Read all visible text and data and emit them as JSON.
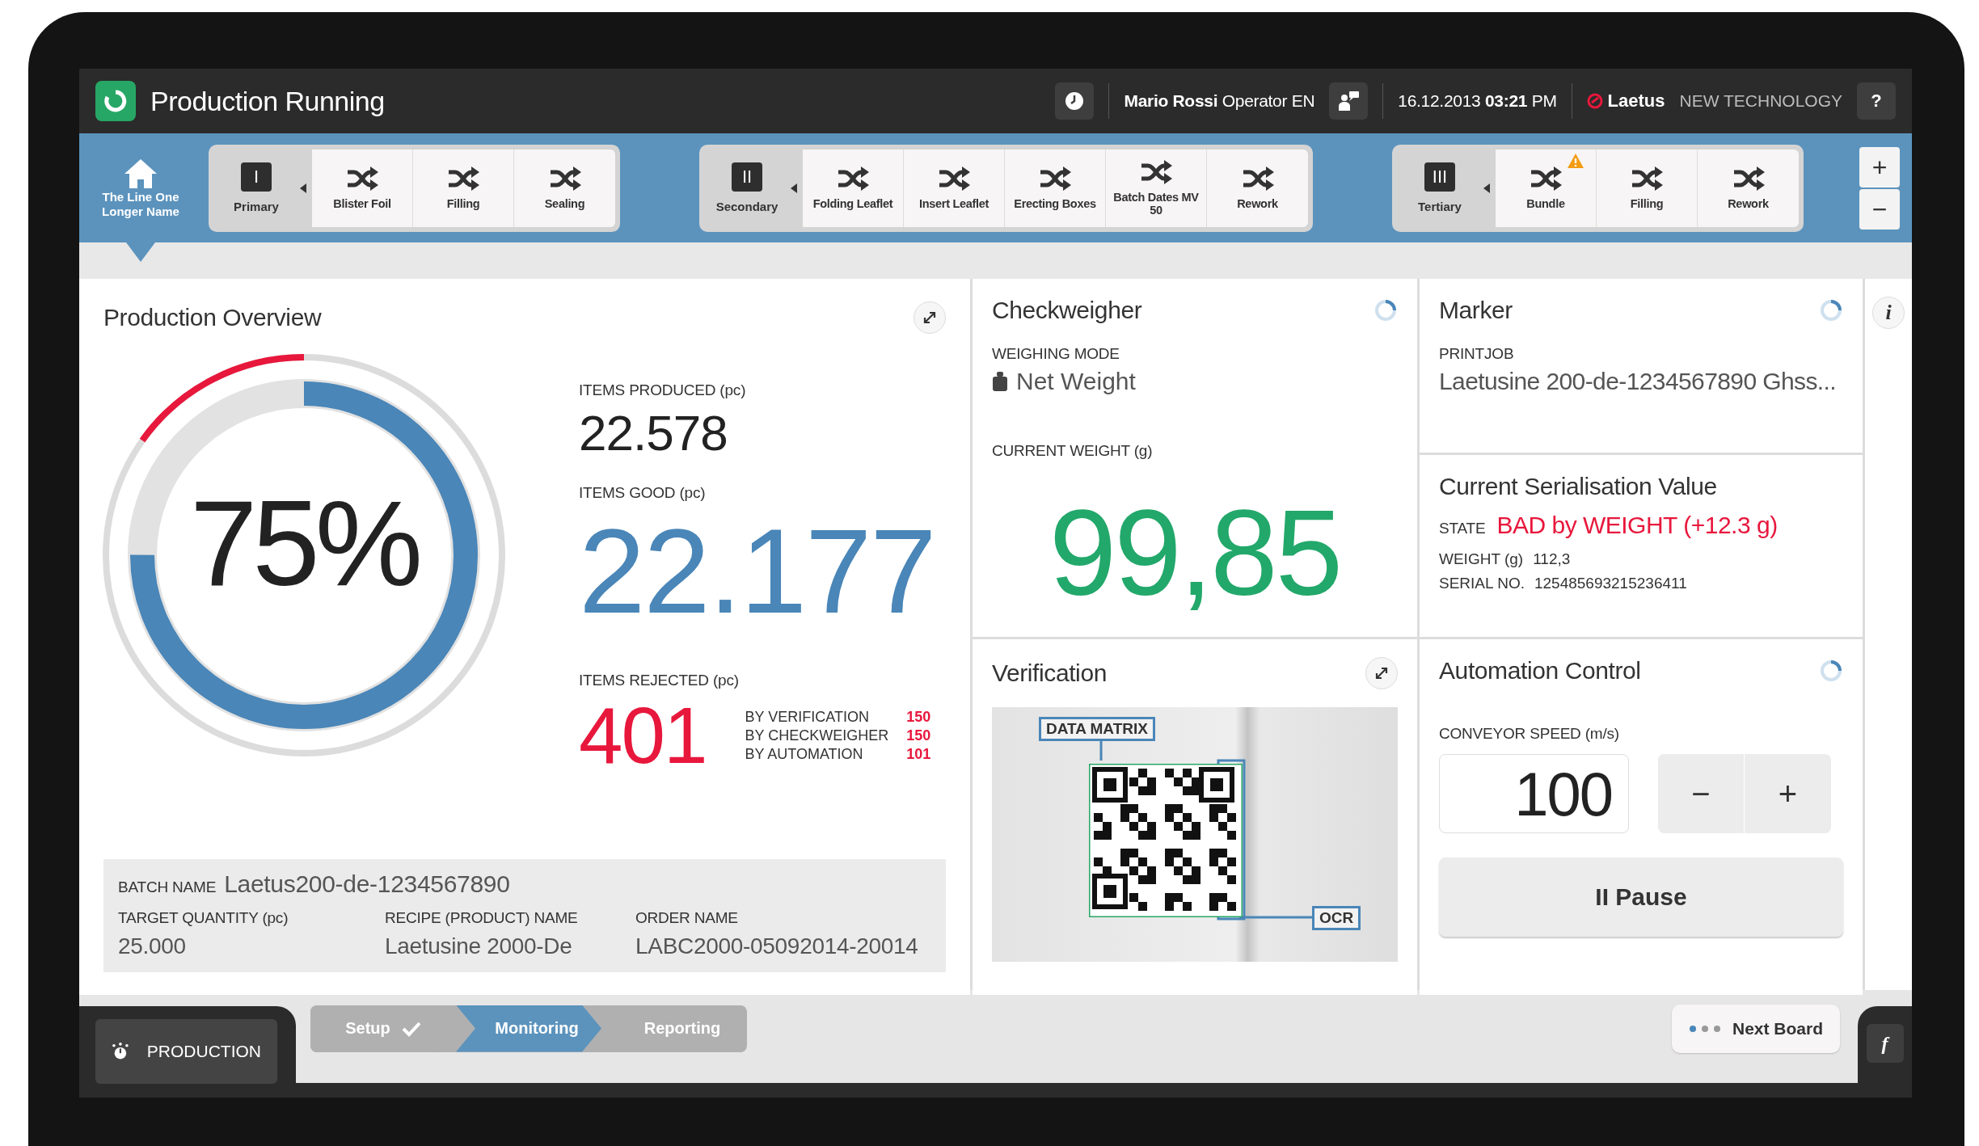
{
  "header": {
    "title": "Production Running",
    "user": "**Mario Rossi** Operator EN",
    "datetime": "16.12.2013 **03:21** PM",
    "brand": "Laetus",
    "brand_tagline": "NEW TECHNOLOGY",
    "help": "?"
  },
  "line": {
    "name": "The Line One Longer Name",
    "selected": true
  },
  "groups": [
    {
      "name": "Primary",
      "numeral": "I",
      "stations": [
        {
          "label": "Blister Foil",
          "warning": false
        },
        {
          "label": "Filling",
          "warning": false
        },
        {
          "label": "Sealing",
          "warning": false
        }
      ]
    },
    {
      "name": "Secondary",
      "numeral": "II",
      "stations": [
        {
          "label": "Folding Leaflet",
          "warning": false
        },
        {
          "label": "Insert Leaflet",
          "warning": false
        },
        {
          "label": "Erecting Boxes",
          "warning": false
        },
        {
          "label": "Batch Dates MV 50",
          "warning": false
        },
        {
          "label": "Rework",
          "warning": false
        }
      ]
    },
    {
      "name": "Tertiary",
      "numeral": "III",
      "stations": [
        {
          "label": "Bundle",
          "warning": true
        },
        {
          "label": "Filling",
          "warning": false
        },
        {
          "label": "Rework",
          "warning": false
        }
      ]
    }
  ],
  "zoom": [
    "+",
    "−"
  ],
  "overview": {
    "title": "Production Overview",
    "level": 0.75,
    "percent": "75%",
    "produced_label": "ITEMS PRODUCED (pc)",
    "produced": "22.578",
    "good_label": "ITEMS GOOD (pc)",
    "good": "22.177",
    "rejected_label": "ITEMS REJECTED (pc)",
    "rejected": "401",
    "reject_reasons": [
      {
        "label": "BY VERIFICATION",
        "value": "150"
      },
      {
        "label": "BY CHECKWEIGHER",
        "value": "150"
      },
      {
        "label": "BY AUTOMATION",
        "value": "101"
      }
    ],
    "batch_label": "BATCH NAME",
    "batch": "Laetus200-de-1234567890",
    "details": [
      {
        "label": "TARGET QUANTITY (pc)",
        "value": "25.000"
      },
      {
        "label": "RECIPE (PRODUCT) NAME",
        "value": "Laetusine 2000-De"
      },
      {
        "label": "ORDER NAME",
        "value": "LABC2000-05092014-20014"
      }
    ]
  },
  "checkweigher": {
    "title": "Checkweigher",
    "mode_label": "WEIGHING MODE",
    "mode": "Net Weight",
    "weight_label": "CURRENT WEIGHT (g)",
    "weight": "99,85"
  },
  "verification": {
    "title": "Verification",
    "code_label": "DATA MATRIX",
    "ocr_label": "OCR"
  },
  "marker": {
    "title": "Marker",
    "printjob_label": "PRINTJOB",
    "printjob": "Laetusine 200-de-1234567890 Ghss..."
  },
  "serialisation": {
    "title": "Current Serialisation Value",
    "state_label": "STATE",
    "state": "BAD by WEIGHT (+12.3 g)",
    "weight_label": "WEIGHT (g)",
    "weight": "112,3",
    "serial_label": "SERIAL NO.",
    "serial": "125485693215236411"
  },
  "automation": {
    "title": "Automation Control",
    "speed_label": "CONVEYOR SPEED (m/s)",
    "speed": "100",
    "minus": "−",
    "plus": "+",
    "pause": "II Pause"
  },
  "info": "i",
  "footer": {
    "mode": "PRODUCTION",
    "steps": [
      {
        "label": "Setup",
        "done": true,
        "selected": false
      },
      {
        "label": "Monitoring",
        "done": false,
        "selected": true
      },
      {
        "label": "Reporting",
        "done": false,
        "selected": false
      }
    ],
    "next": "Next Board",
    "function": "f"
  }
}
